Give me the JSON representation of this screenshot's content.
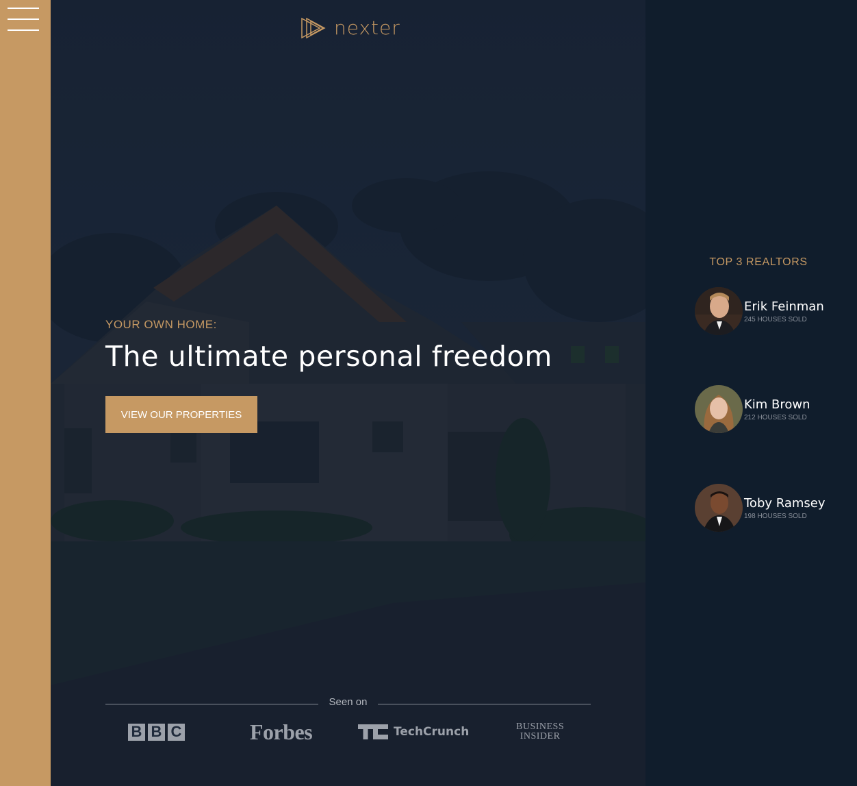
{
  "brand": {
    "name": "nexter",
    "accent": "#c69963",
    "dark": "#101d2c"
  },
  "nav": {
    "menu_icon": "hamburger-icon"
  },
  "hero": {
    "subheading": "YOUR OWN HOME:",
    "heading": "The ultimate personal freedom",
    "cta_label": "VIEW OUR PROPERTIES"
  },
  "seen_on": {
    "label": "Seen on",
    "logos": [
      "BBC",
      "Forbes",
      "TechCrunch",
      "BUSINESS INSIDER"
    ],
    "bbc_letters": [
      "B",
      "B",
      "C"
    ],
    "forbes": "Forbes",
    "techcrunch": "TechCrunch",
    "bi_line1": "BUSINESS",
    "bi_line2": "INSIDER"
  },
  "realtors": {
    "title": "TOP 3 REALTORS",
    "items": [
      {
        "name": "Erik Feinman",
        "sold": "245 HOUSES SOLD"
      },
      {
        "name": "Kim Brown",
        "sold": "212 HOUSES SOLD"
      },
      {
        "name": "Toby Ramsey",
        "sold": "198 HOUSES SOLD"
      }
    ]
  }
}
